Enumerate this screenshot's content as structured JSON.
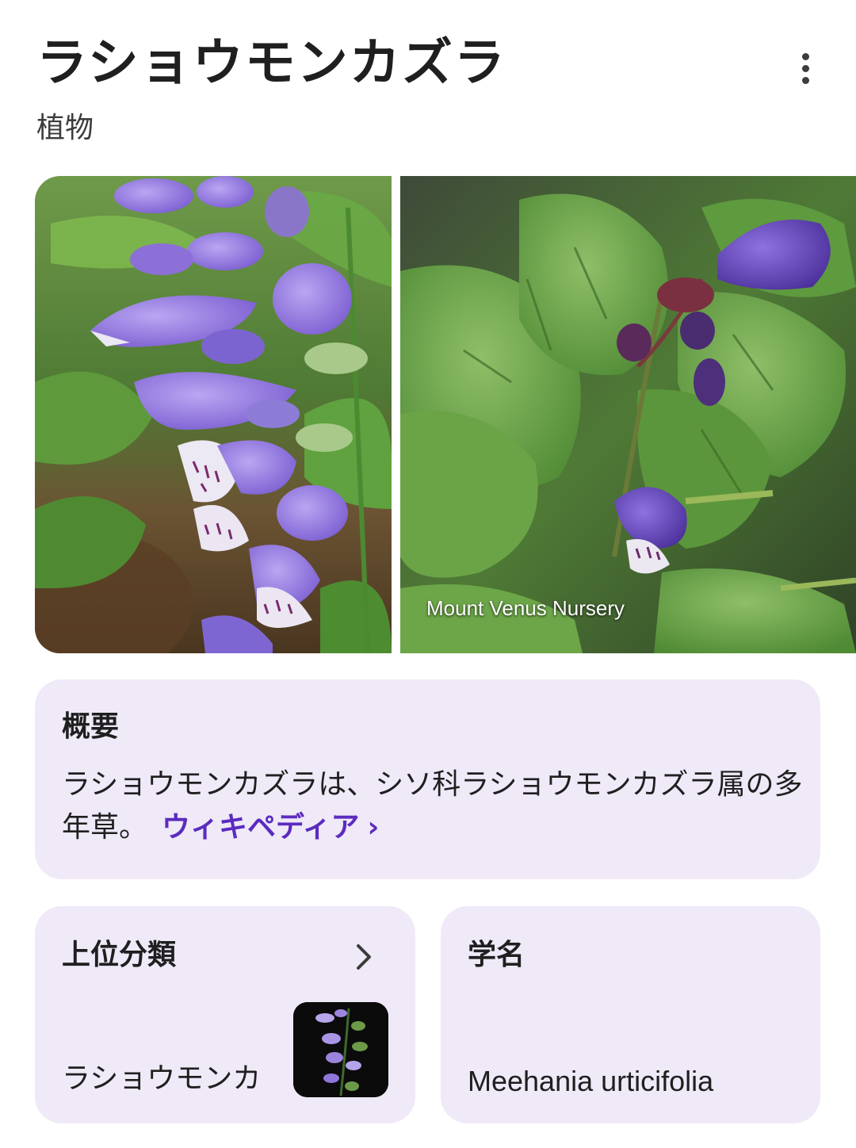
{
  "header": {
    "title": "ラショウモンカズラ",
    "subtitle": "植物",
    "more_icon": "more-vert-icon"
  },
  "images": {
    "photo_1_alt": "",
    "photo_2_credit": "Mount Venus Nursery"
  },
  "overview": {
    "heading": "概要",
    "text": "ラショウモンカズラは、シソ科ラショウモンカズラ属の多年草。",
    "link_label": "ウィキペディア",
    "link_chevron": "›"
  },
  "taxonomy": {
    "heading": "上位分類",
    "value": "ラショウモンカ",
    "chevron_icon": "chevron-right-icon"
  },
  "scientific_name": {
    "heading": "学名",
    "value": "Meehania urticifolia"
  },
  "colors": {
    "card_background": "#efe9f8",
    "link": "#5b2bbf",
    "text": "#1f1f1f"
  }
}
